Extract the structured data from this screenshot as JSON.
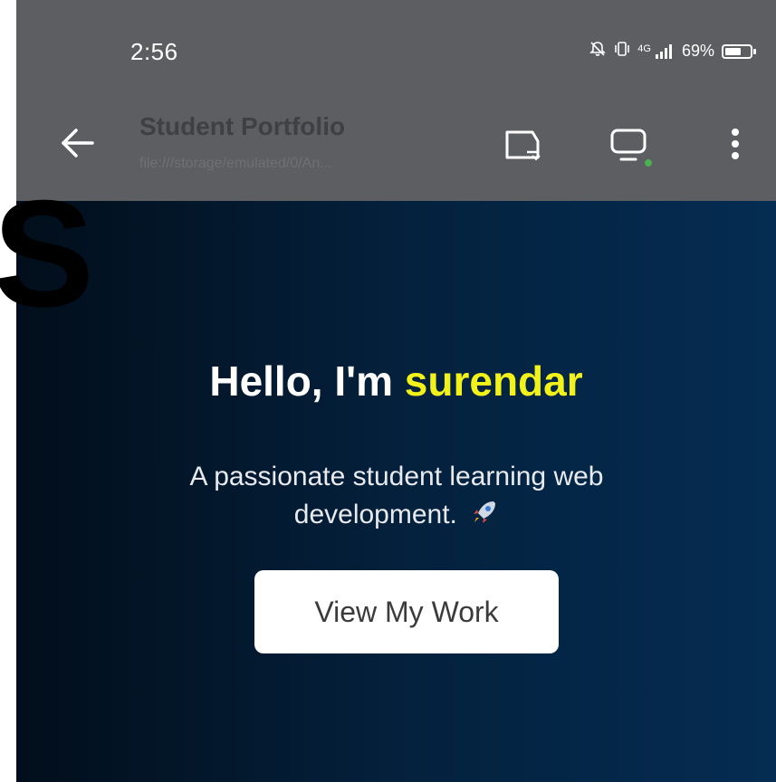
{
  "status_bar": {
    "time": "2:56",
    "signal_label": "4G",
    "battery_percent": "69%",
    "battery_level": 0.69
  },
  "toolbar": {
    "title": "Student Portfolio",
    "url": "file:///storage/emulated/0/An..."
  },
  "hero": {
    "greeting": "Hello, I'm ",
    "name": "surendar",
    "subtitle": "A passionate student learning web development.",
    "cta_label": "View My Work"
  },
  "overlay": {
    "edge_glyph": "S"
  },
  "colors": {
    "accent_name": "#f2f21a",
    "toolbar_bg": "#5d5e62",
    "page_bg_start": "#020e1b",
    "page_bg_end": "#052c52",
    "indicator_dot": "#4caf50"
  },
  "icons": [
    "arrow-left-icon",
    "cast-icon",
    "desktop-icon",
    "more-vert-icon",
    "bell-off-icon",
    "vibrate-icon",
    "signal-icon",
    "battery-icon",
    "rocket-icon"
  ]
}
